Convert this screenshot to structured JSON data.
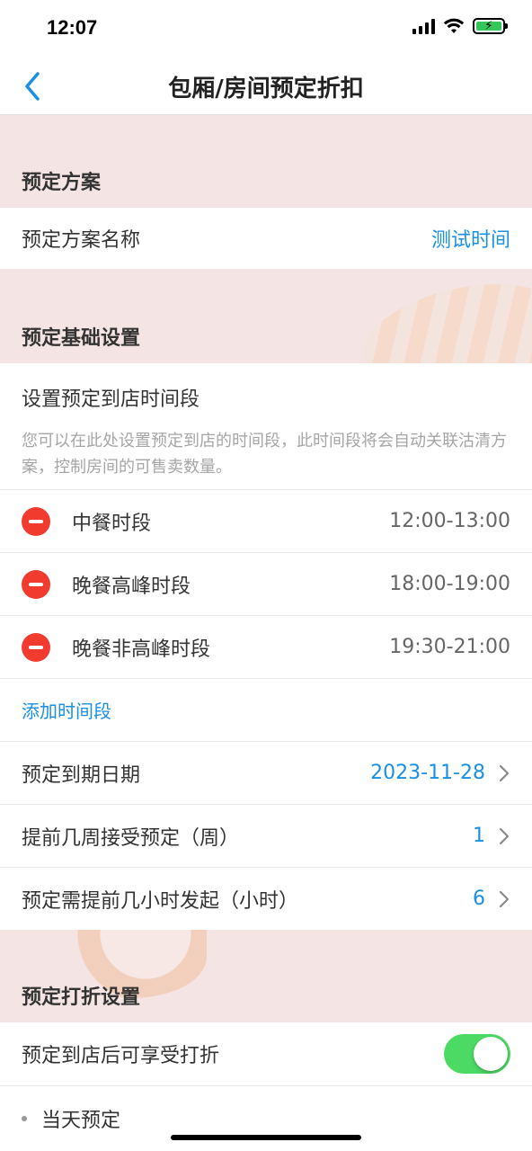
{
  "status_bar": {
    "time": "12:07"
  },
  "nav": {
    "title": "包厢/房间预定折扣"
  },
  "plan_section": {
    "header": "预定方案",
    "name_label": "预定方案名称",
    "name_value": "测试时间"
  },
  "basic_section": {
    "header": "预定基础设置",
    "time_slot_title": "设置预定到店时间段",
    "time_slot_desc": "您可以在此处设置预定到店的时间段，此时间段将会自动关联沽清方案，控制房间的可售卖数量。",
    "slots": [
      {
        "name": "中餐时段",
        "time": "12:00-13:00"
      },
      {
        "name": "晚餐高峰时段",
        "time": "18:00-19:00"
      },
      {
        "name": "晚餐非高峰时段",
        "time": "19:30-21:00"
      }
    ],
    "add_slot_label": "添加时间段",
    "expiry_label": "预定到期日期",
    "expiry_value": "2023-11-28",
    "weeks_label": "提前几周接受预定（周）",
    "weeks_value": "1",
    "hours_label": "预定需提前几小时发起（小时）",
    "hours_value": "6"
  },
  "discount_section": {
    "header": "预定打折设置",
    "discount_toggle_label": "预定到店后可享受打折",
    "discount_toggle_on": true,
    "same_day_label": "当天预定"
  },
  "colors": {
    "accent": "#1a8fe3",
    "toggle_on": "#4cd964",
    "delete": "#f23b2f",
    "background": "#f5e4e4"
  }
}
